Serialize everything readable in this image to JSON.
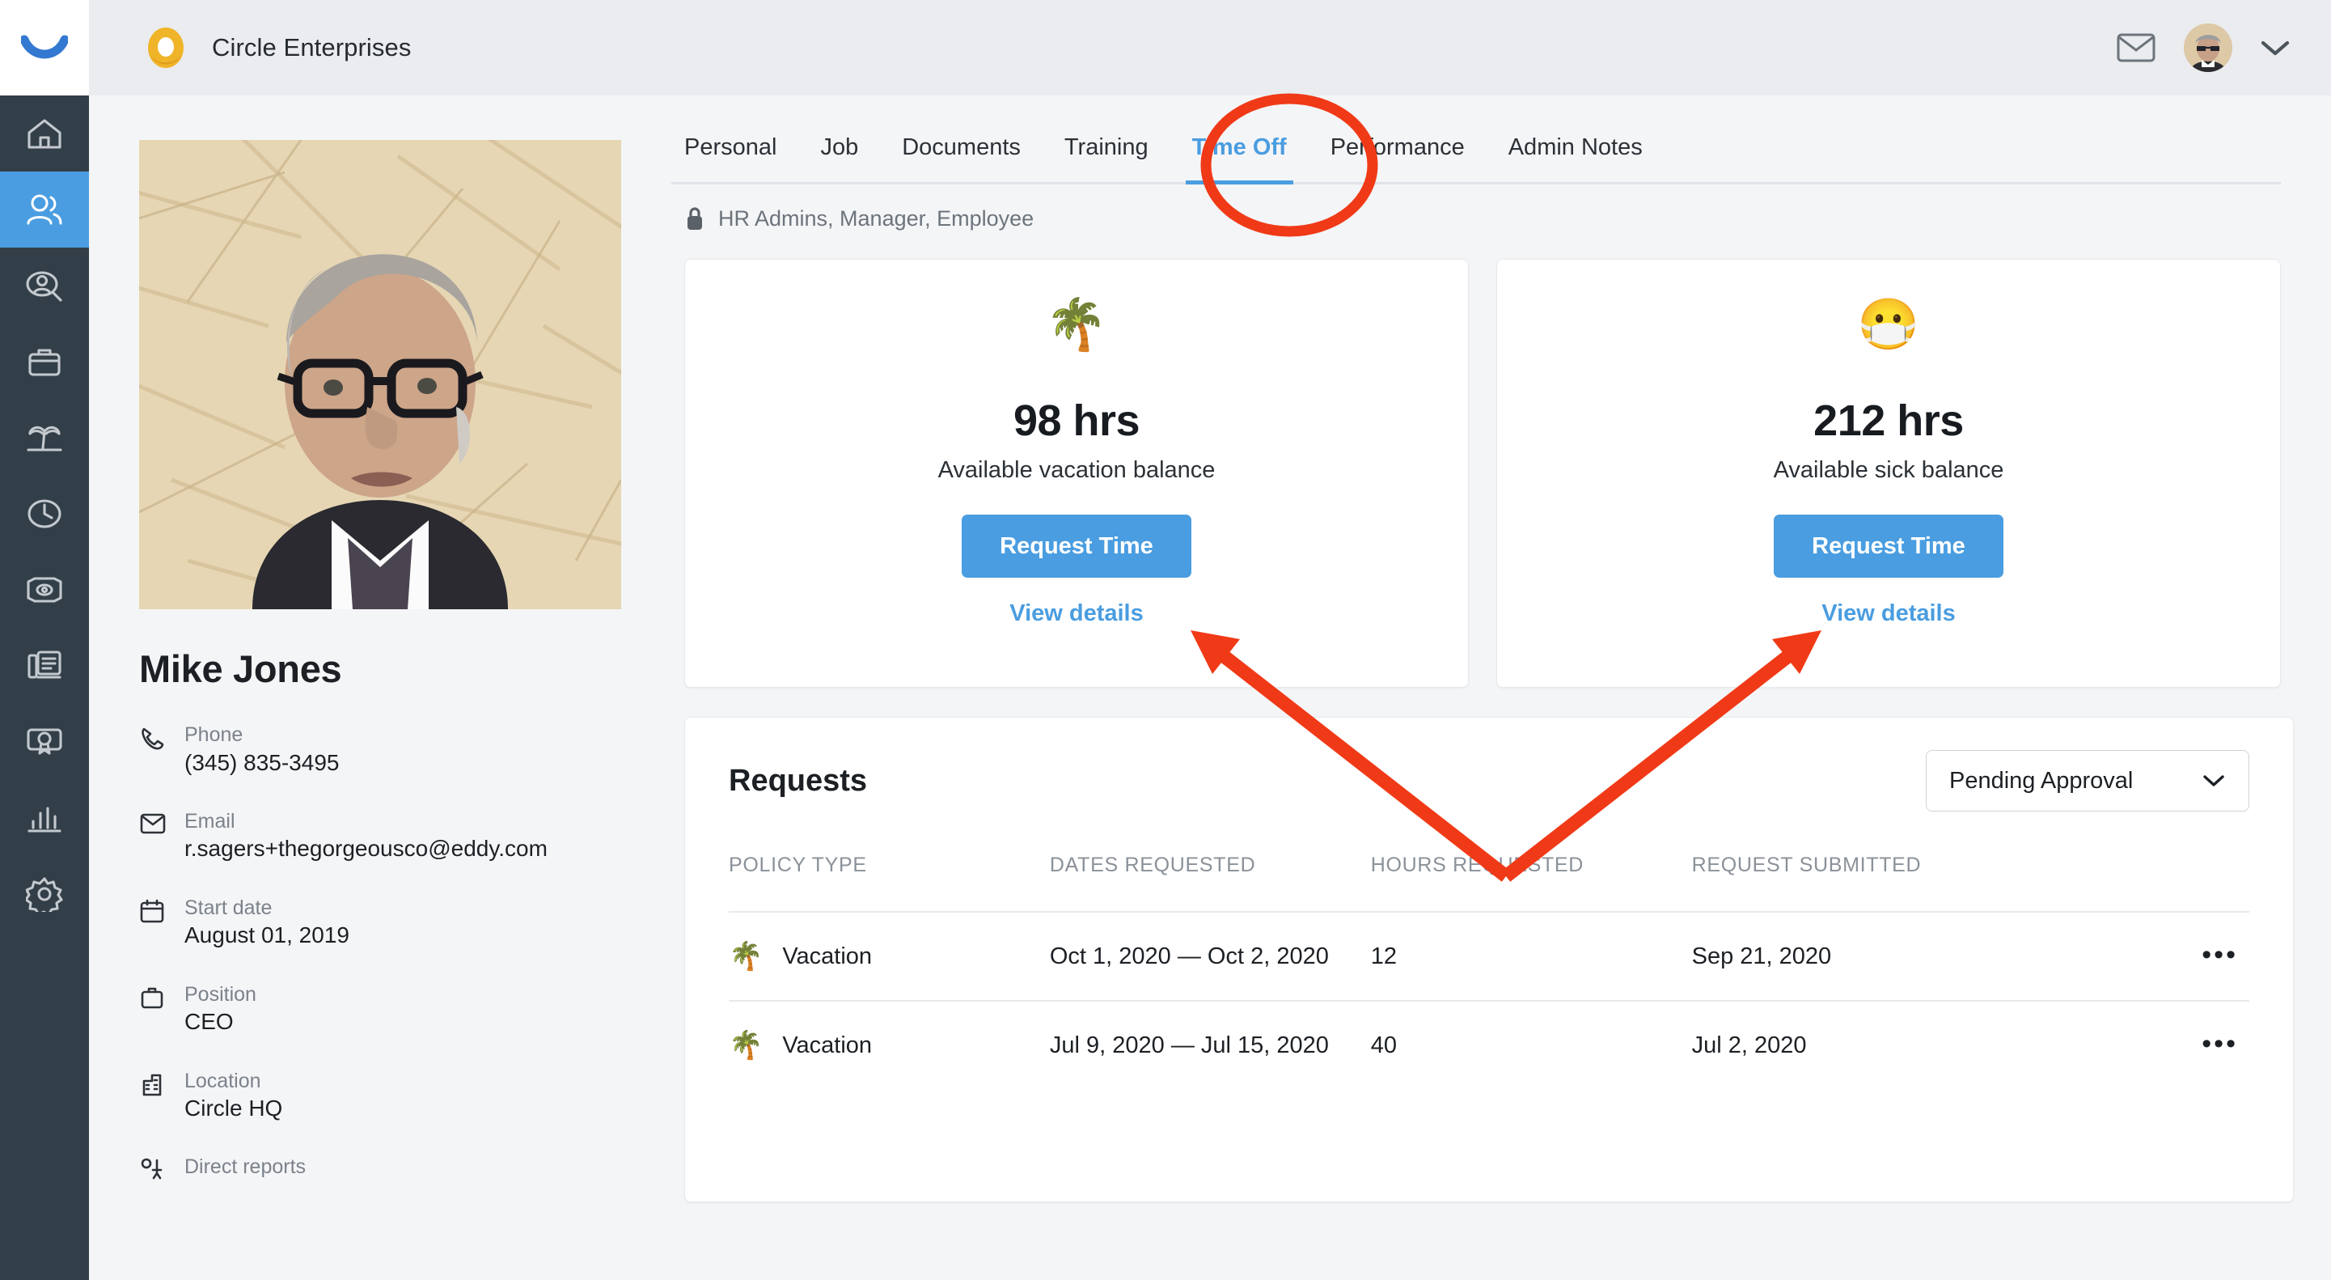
{
  "app": {
    "logo_icon": "eddy-smile-logo",
    "company_name": "Circle Enterprises",
    "company_mark_icon": "circle-ring-logo"
  },
  "topbar": {
    "mail_icon": "mail-icon",
    "avatar_icon": "user-avatar",
    "chevron_icon": "chevron-down-icon"
  },
  "sidebar": {
    "items": [
      {
        "icon": "home-icon",
        "name": "home"
      },
      {
        "icon": "people-icon",
        "name": "people"
      },
      {
        "icon": "person-search-icon",
        "name": "recruiting"
      },
      {
        "icon": "briefcase-icon",
        "name": "onboarding"
      },
      {
        "icon": "palm-tree-icon",
        "name": "time-off"
      },
      {
        "icon": "clock-icon",
        "name": "time-tracking"
      },
      {
        "icon": "money-eye-icon",
        "name": "payroll"
      },
      {
        "icon": "documents-icon",
        "name": "documents"
      },
      {
        "icon": "award-icon",
        "name": "training"
      },
      {
        "icon": "bar-chart-icon",
        "name": "reports"
      },
      {
        "icon": "gear-icon",
        "name": "settings"
      }
    ],
    "active_index": 1
  },
  "profile": {
    "name": "Mike Jones",
    "photo_alt": "employee-headshot",
    "fields": [
      {
        "icon": "phone-icon",
        "label": "Phone",
        "value": "(345) 835-3495"
      },
      {
        "icon": "mail-icon",
        "label": "Email",
        "value": "r.sagers+thegorgeousco@eddy.com"
      },
      {
        "icon": "calendar-icon",
        "label": "Start date",
        "value": "August 01, 2019"
      },
      {
        "icon": "briefcase-icon",
        "label": "Position",
        "value": "CEO"
      },
      {
        "icon": "building-icon",
        "label": "Location",
        "value": "Circle HQ"
      },
      {
        "icon": "org-icon",
        "label": "Direct reports",
        "value": ""
      }
    ]
  },
  "tabs": {
    "items": [
      {
        "label": "Personal"
      },
      {
        "label": "Job"
      },
      {
        "label": "Documents"
      },
      {
        "label": "Training"
      },
      {
        "label": "Time Off"
      },
      {
        "label": "Performance"
      },
      {
        "label": "Admin Notes"
      }
    ],
    "active_index": 4
  },
  "permissions": {
    "icon": "lock-icon",
    "text": "HR Admins, Manager, Employee"
  },
  "balances": [
    {
      "emoji": "🌴",
      "emoji_name": "palm-tree-emoji",
      "hours": "98 hrs",
      "subtitle": "Available vacation balance",
      "button_label": "Request Time",
      "link_label": "View details"
    },
    {
      "emoji": "😷",
      "emoji_name": "masked-face-emoji",
      "hours": "212 hrs",
      "subtitle": "Available sick balance",
      "button_label": "Request Time",
      "link_label": "View details"
    }
  ],
  "requests": {
    "title": "Requests",
    "filter": {
      "value": "Pending Approval",
      "chevron_icon": "chevron-down-icon"
    },
    "columns": [
      "POLICY TYPE",
      "DATES REQUESTED",
      "HOURS REQUESTED",
      "REQUEST SUBMITTED",
      ""
    ],
    "rows": [
      {
        "emoji": "🌴",
        "policy_type": "Vacation",
        "dates_requested": "Oct 1, 2020 — Oct 2, 2020",
        "hours_requested": "12",
        "request_submitted": "Sep 21, 2020",
        "menu_icon": "kebab-menu-icon",
        "menu_glyph": "•••"
      },
      {
        "emoji": "🌴",
        "policy_type": "Vacation",
        "dates_requested": "Jul 9, 2020 — Jul 15, 2020",
        "hours_requested": "40",
        "request_submitted": "Jul 2, 2020",
        "menu_icon": "kebab-menu-icon",
        "menu_glyph": "•••"
      }
    ]
  },
  "annotations": {
    "color": "#F03A17",
    "ellipse_target": "Time Off tab",
    "arrow_targets": [
      "vacation Request Time button",
      "sick Request Time button"
    ]
  },
  "colors": {
    "accent_blue": "#4A9DE0",
    "rail_dark": "#333F48",
    "page_bg": "#F4F5F7",
    "topbar_bg": "#EAECEF",
    "annotation_red": "#F03A17",
    "logo_gold": "#F0B429"
  }
}
